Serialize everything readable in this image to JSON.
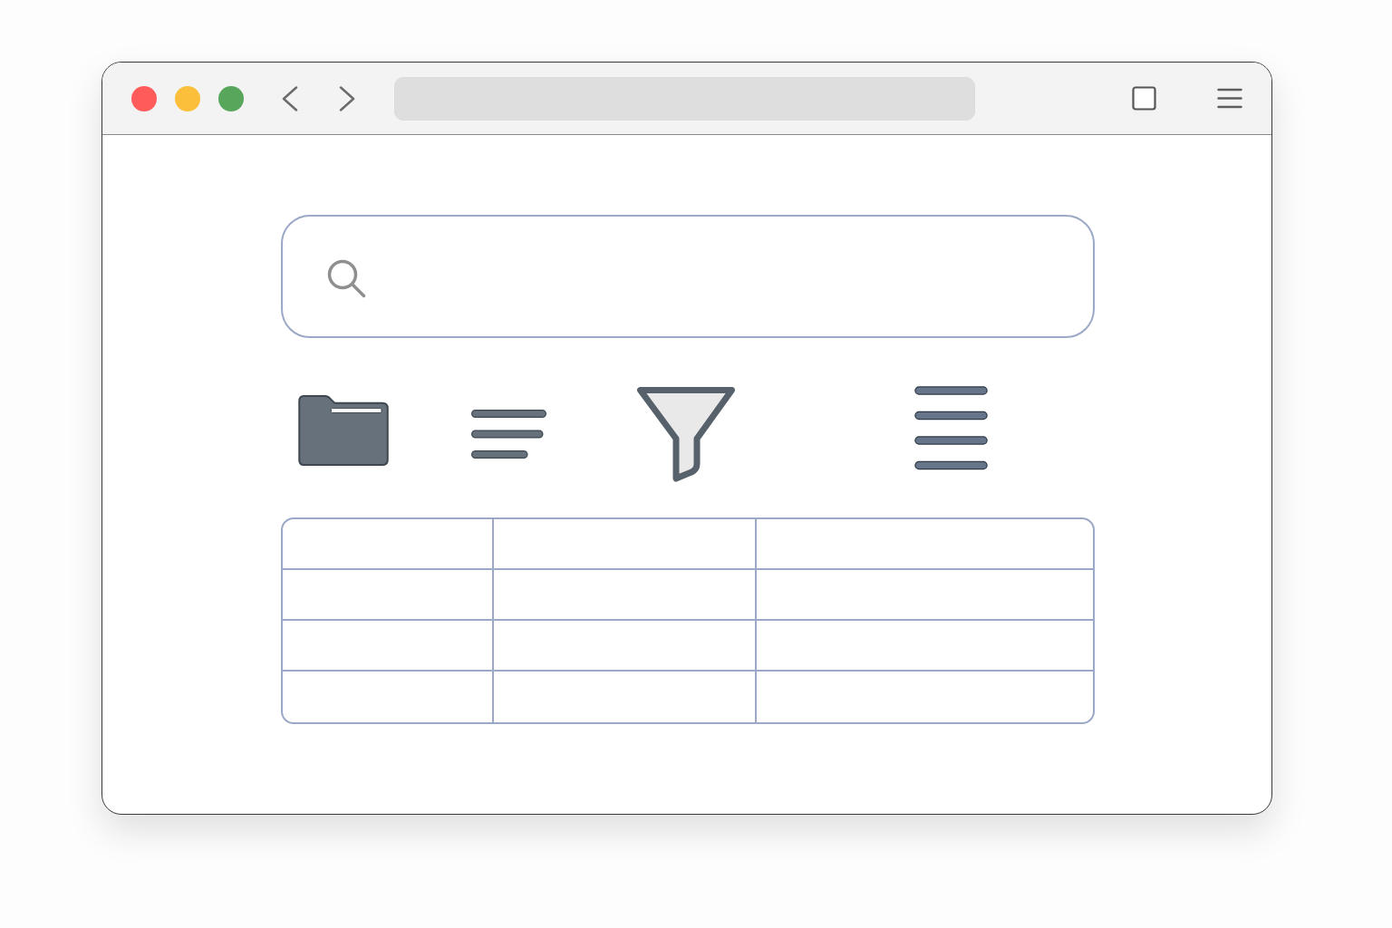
{
  "window": {
    "controls": [
      {
        "color": "#ff5b5b"
      },
      {
        "color": "#fbbf3b"
      },
      {
        "color": "#58a65c"
      }
    ]
  }
}
